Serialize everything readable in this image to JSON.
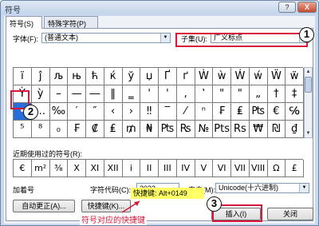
{
  "window": {
    "title": "符号",
    "help_label": "?",
    "close_label": "X"
  },
  "tabs": [
    {
      "label": "符号(S)"
    },
    {
      "label": "特殊字符(P)"
    }
  ],
  "font": {
    "label": "字体(F):",
    "value": "(普通文本)"
  },
  "subset": {
    "label": "子集(U):",
    "value": "广义标点"
  },
  "symbol_grid": [
    [
      "ï",
      "ĵ",
      "љ",
      "њ",
      "ћ",
      "ќ",
      "ў",
      "џ",
      "Ґ",
      "ґ",
      "Ẁ",
      "ẁ",
      "Ẃ",
      "ẃ",
      "Ẅ",
      "ẅ"
    ],
    [
      "Ỳ",
      "ỳ",
      "–",
      "—",
      "―",
      "‖",
      "‗",
      "'",
      "'",
      "‚",
      "‛",
      "\"",
      "\"",
      "„",
      "†",
      "‡"
    ],
    [
      "•",
      "…",
      "‰",
      "′",
      "″",
      "‹",
      "›",
      "‼",
      "‾",
      "⁄",
      "ⁿ",
      "₣",
      "₤",
      "₧",
      "€",
      "℅"
    ],
    [
      "⁵",
      "⁸",
      "₀",
      "₣",
      "₡",
      "₤",
      "₥",
      "₦",
      "₧",
      "₨",
      "№",
      "Pts",
      "Rs",
      "₩",
      "₪",
      "₫"
    ]
  ],
  "selected_symbol": "•",
  "recent": {
    "label": "近期使用过的符号(R):",
    "symbols": [
      "€",
      "m²",
      "³⁄₈",
      "X",
      "XI",
      "XII",
      "i",
      "II",
      "III",
      "IV",
      "V",
      "VI",
      "VII",
      "VIII",
      "Ω",
      "£"
    ]
  },
  "symbol_name": "加着号",
  "char_code": {
    "label": "字符代码(C):",
    "value": "2022"
  },
  "from": {
    "label": "来自(M):",
    "value": "Unicode(十六进制)"
  },
  "buttons": {
    "autocorrect": "自动更正(A)...",
    "shortcut_key": "快捷键(K)...",
    "insert": "插入(I)",
    "close": "关闭"
  },
  "shortcut_text": "快捷键: Alt+0149",
  "annotations": {
    "caption": "符号对应的快捷键",
    "markers": [
      "1",
      "2",
      "3"
    ]
  },
  "colors": {
    "highlight_red": "#d8183a",
    "selection_blue": "#2a6fd8",
    "shortcut_yellow": "#ffff66"
  }
}
